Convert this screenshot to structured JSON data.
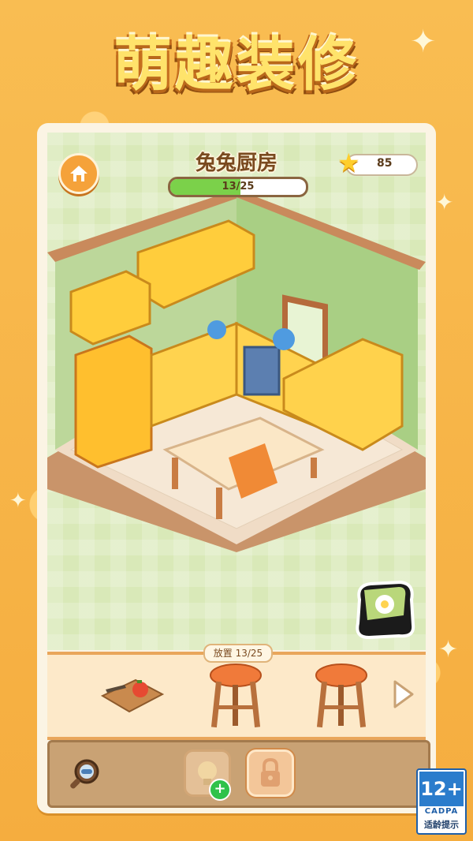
{
  "banner": {
    "title": "萌趣装修"
  },
  "hud": {
    "room_name": "兔兔厨房",
    "progress_text": "13/25",
    "progress_fraction": 0.52,
    "stars_count": "85"
  },
  "tray": {
    "label": "放置 13/25",
    "items": [
      "cutting-board-icon",
      "stool-icon",
      "stool-icon"
    ]
  },
  "rating": {
    "age": "12+",
    "org": "CADPA",
    "tip": "适龄提示"
  },
  "colors": {
    "accent": "#f5a23a",
    "progress_fill": "#7bd14a",
    "rating_blue": "#2a7ccc"
  }
}
